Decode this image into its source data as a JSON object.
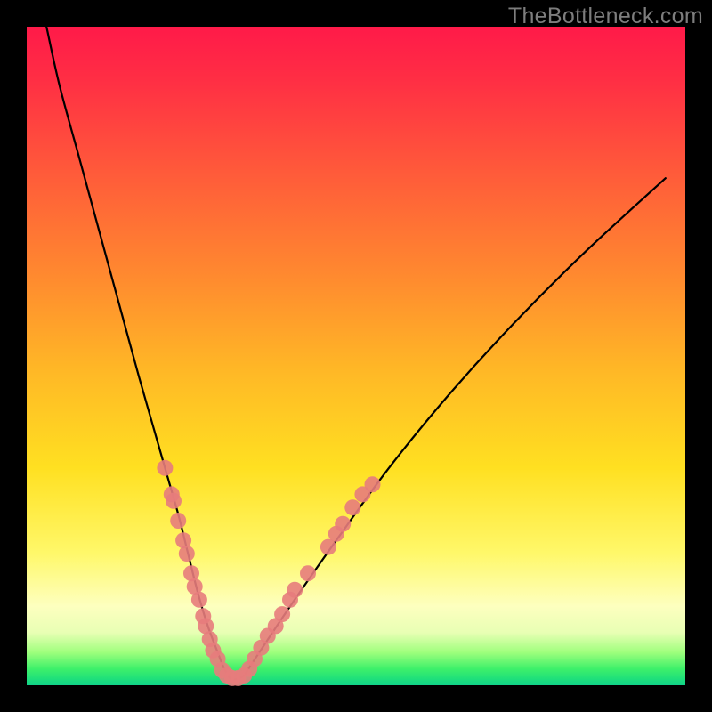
{
  "watermark": "TheBottleneck.com",
  "chart_data": {
    "type": "line",
    "title": "",
    "xlabel": "",
    "ylabel": "",
    "xlim": [
      0,
      100
    ],
    "ylim": [
      0,
      100
    ],
    "grid": false,
    "legend": false,
    "series": [
      {
        "name": "bottleneck-curve",
        "color": "#000000",
        "x": [
          3,
          5,
          8,
          11,
          14,
          17,
          19,
          21,
          23,
          24.5,
          26,
          27.5,
          29,
          30,
          31,
          32,
          33,
          34,
          40,
          47,
          55,
          64,
          74,
          85,
          97
        ],
        "values": [
          100,
          91,
          80,
          69,
          58,
          47,
          40,
          33,
          26,
          20,
          14,
          9,
          5,
          2.5,
          1,
          1,
          1.5,
          3,
          12,
          22,
          33,
          44,
          55,
          66,
          77
        ]
      }
    ],
    "markers": {
      "name": "highlighted-range",
      "color": "#e77c7c",
      "radius_px": 9,
      "points": [
        {
          "x": 21.0,
          "y": 33.0
        },
        {
          "x": 22.0,
          "y": 29.0
        },
        {
          "x": 22.3,
          "y": 28.0
        },
        {
          "x": 23.0,
          "y": 25.0
        },
        {
          "x": 23.8,
          "y": 22.0
        },
        {
          "x": 24.3,
          "y": 20.0
        },
        {
          "x": 25.0,
          "y": 17.0
        },
        {
          "x": 25.5,
          "y": 15.0
        },
        {
          "x": 26.2,
          "y": 13.0
        },
        {
          "x": 26.8,
          "y": 10.5
        },
        {
          "x": 27.2,
          "y": 9.0
        },
        {
          "x": 27.8,
          "y": 7.0
        },
        {
          "x": 28.3,
          "y": 5.3
        },
        {
          "x": 29.0,
          "y": 4.0
        },
        {
          "x": 29.7,
          "y": 2.3
        },
        {
          "x": 30.4,
          "y": 1.5
        },
        {
          "x": 31.2,
          "y": 1.1
        },
        {
          "x": 32.1,
          "y": 1.1
        },
        {
          "x": 33.0,
          "y": 1.5
        },
        {
          "x": 33.8,
          "y": 2.5
        },
        {
          "x": 34.6,
          "y": 4.0
        },
        {
          "x": 35.6,
          "y": 5.7
        },
        {
          "x": 36.6,
          "y": 7.5
        },
        {
          "x": 37.8,
          "y": 9.0
        },
        {
          "x": 38.8,
          "y": 10.8
        },
        {
          "x": 40.0,
          "y": 13.0
        },
        {
          "x": 40.7,
          "y": 14.5
        },
        {
          "x": 42.7,
          "y": 17.0
        },
        {
          "x": 45.8,
          "y": 21.0
        },
        {
          "x": 47.0,
          "y": 23.0
        },
        {
          "x": 48.0,
          "y": 24.5
        },
        {
          "x": 49.5,
          "y": 27.0
        },
        {
          "x": 51.0,
          "y": 29.0
        },
        {
          "x": 52.5,
          "y": 30.5
        }
      ]
    }
  }
}
